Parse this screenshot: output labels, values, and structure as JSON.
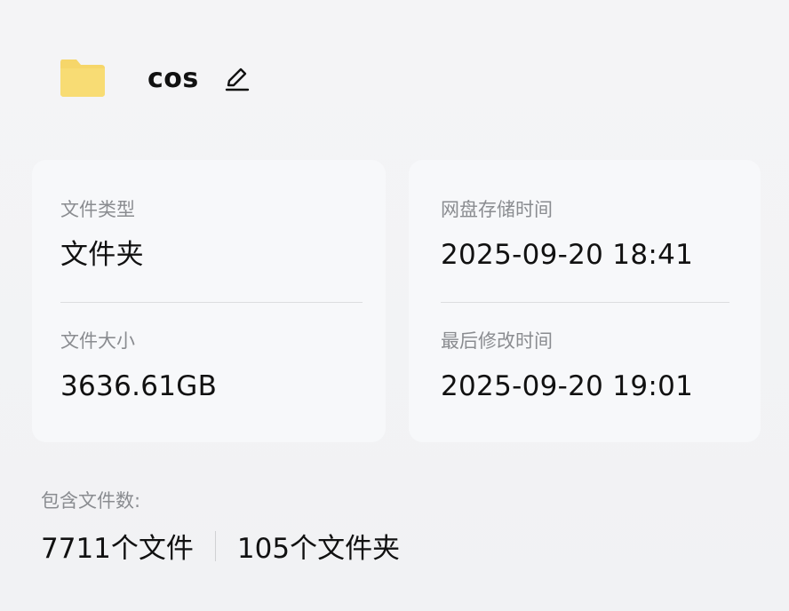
{
  "header": {
    "folder_icon": "folder-icon",
    "folder_name": "cos",
    "edit_icon": "pencil-icon"
  },
  "details": {
    "file_type_label": "文件类型",
    "file_type_value": "文件夹",
    "file_size_label": "文件大小",
    "file_size_value": "3636.61GB",
    "stored_time_label": "网盘存储时间",
    "stored_time_value": "2025-09-20 18:41",
    "modified_time_label": "最后修改时间",
    "modified_time_value": "2025-09-20 19:01"
  },
  "contents": {
    "label": "包含文件数:",
    "files": "7711个文件",
    "folders": "105个文件夹"
  },
  "colors": {
    "folder": "#f6d66a",
    "background": "#f2f3f5",
    "card": "#f7f8fa",
    "label": "#8a8c90"
  }
}
